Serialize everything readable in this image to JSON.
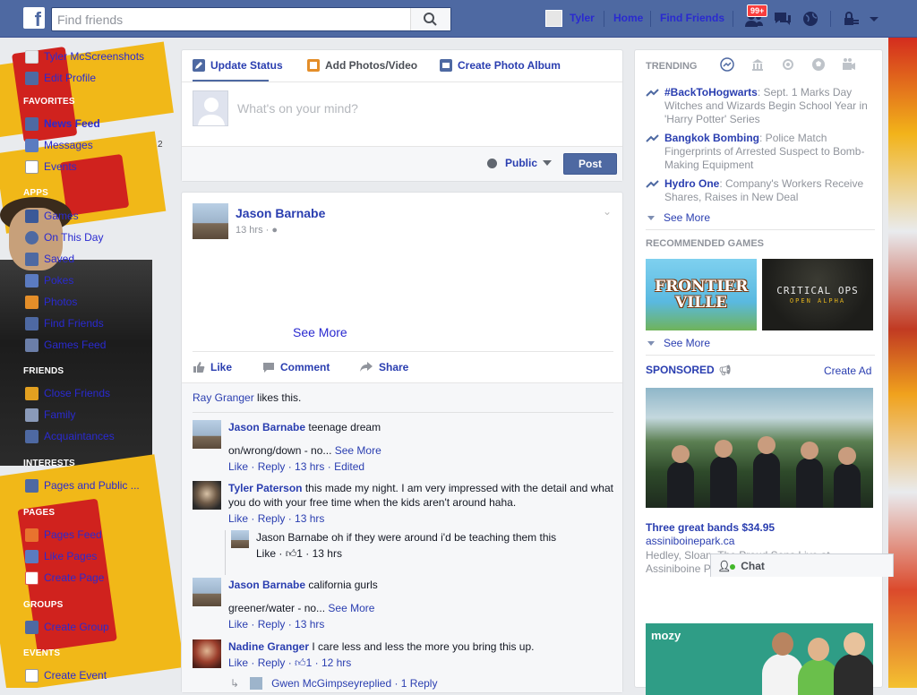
{
  "topbar": {
    "logo": "f",
    "search_placeholder": "Find friends",
    "user_name": "Tyler",
    "home_label": "Home",
    "find_friends_label": "Find Friends",
    "notification_badge": "99+"
  },
  "sidebar": {
    "profile_name": "Tyler McScreenshots",
    "edit_profile": "Edit Profile",
    "favorites_header": "FAVORITES",
    "news_feed": "News Feed",
    "messages": "Messages",
    "messages_count": "2",
    "events_fav": "Events",
    "apps_header": "APPS",
    "games": "Games",
    "on_this_day": "On This Day",
    "saved": "Saved",
    "pokes": "Pokes",
    "photos": "Photos",
    "find_friends": "Find Friends",
    "games_feed": "Games Feed",
    "friends_header": "FRIENDS",
    "close_friends": "Close Friends",
    "family": "Family",
    "acquaintances": "Acquaintances",
    "interests_header": "INTERESTS",
    "pages_public": "Pages and Public ...",
    "pages_header": "PAGES",
    "pages_feed": "Pages Feed",
    "like_pages": "Like Pages",
    "create_page": "Create Page",
    "groups_header": "GROUPS",
    "create_group": "Create Group",
    "events_header": "EVENTS",
    "create_event": "Create Event"
  },
  "composer": {
    "tab_update": "Update Status",
    "tab_photos": "Add Photos/Video",
    "tab_album": "Create Photo Album",
    "placeholder": "What's on your mind?",
    "privacy": "Public",
    "post_button": "Post"
  },
  "post": {
    "author": "Jason Barnabe",
    "time": "13 hrs ·",
    "see_more": "See More",
    "like": "Like",
    "comment": "Comment",
    "share": "Share",
    "likes_name": "Ray Granger",
    "likes_suffix": " likes this.",
    "comments": [
      {
        "name": "Jason Barnabe",
        "text": " teenage dream",
        "line2": "on/wrong/down - no... ",
        "see_more": "See More",
        "like": "Like",
        "reply": "Reply",
        "time": "13 hrs",
        "edited": "Edited"
      },
      {
        "name": "Tyler Paterson",
        "text": " this made my night. I am very impressed with the detail and what you do with your free time when the kids aren't around haha.",
        "like": "Like",
        "reply": "Reply",
        "time": "13 hrs"
      },
      {
        "name": "Jason Barnabe",
        "text": " oh if they were around i'd be teaching them this",
        "like": "Like",
        "likes": "1",
        "time": "13 hrs"
      },
      {
        "name": "Jason Barnabe",
        "text": " california gurls",
        "line2": "greener/water - no... ",
        "see_more": "See More",
        "like": "Like",
        "reply": "Reply",
        "time": "13 hrs"
      },
      {
        "name": "Nadine Granger",
        "text": " I care less and less the more you bring this up.",
        "like": "Like",
        "reply": "Reply",
        "likes": "1",
        "time": "12 hrs"
      }
    ],
    "replied_name": "Gwen McGimpsey",
    "replied_text": " replied · 1 Reply"
  },
  "right": {
    "trending_header": "TRENDING",
    "trends": [
      {
        "name": "#BackToHogwarts",
        "text": ": Sept. 1 Marks Day Witches and Wizards Begin School Year in 'Harry Potter' Series"
      },
      {
        "name": "Bangkok Bombing",
        "text": ": Police Match Fingerprints of Arrested Suspect to Bomb-Making Equipment"
      },
      {
        "name": "Hydro One",
        "text": ": Company's Workers Receive Shares, Raises in New Deal"
      }
    ],
    "see_more": "See More",
    "games_header": "RECOMMENDED GAMES",
    "game1": "FRONTIER VILLE",
    "game2": "CRITICAL OPS",
    "game2_sub": "OPEN ALPHA",
    "games_see_more": "See More",
    "sponsored": "SPONSORED",
    "create_ad": "Create Ad",
    "ad1_title": "Three great bands $34.95",
    "ad1_url": "assiniboinepark.ca",
    "ad1_text": "Hedley, Sloan, The Proud Sons Live at Assiniboine Park. Tickets on sale now.",
    "ad2_logo": "mozy"
  },
  "chat": {
    "label": "Chat"
  }
}
